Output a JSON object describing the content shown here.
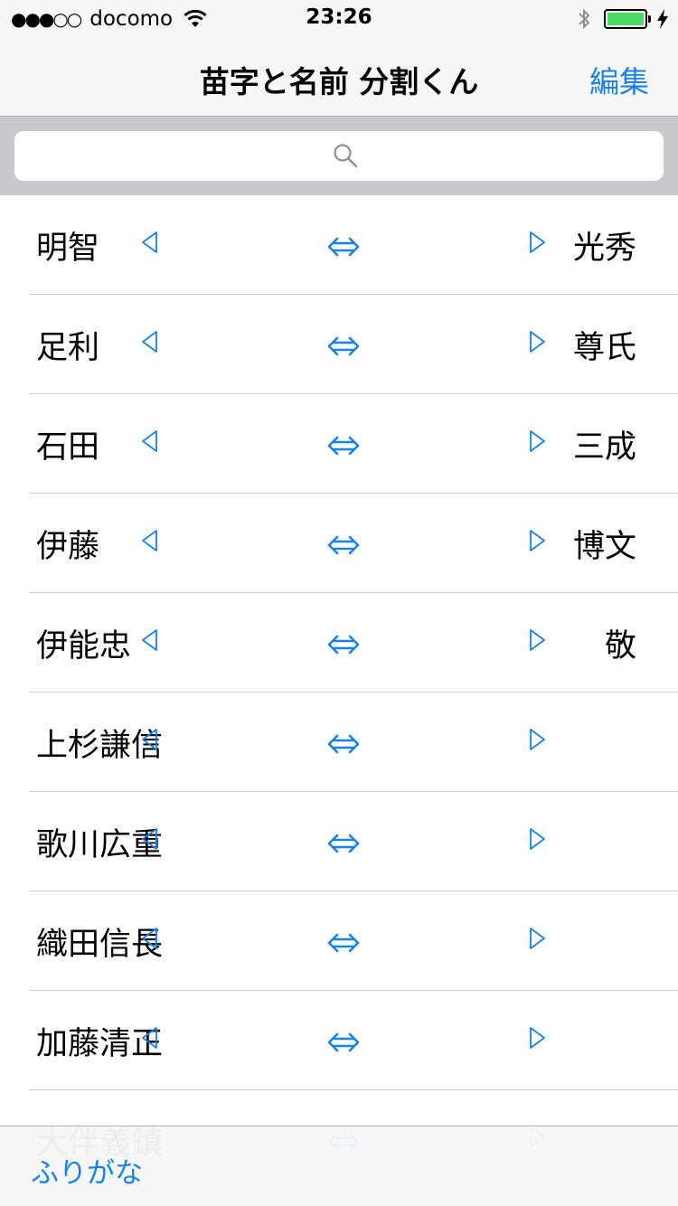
{
  "status_bar": {
    "signal": "●●●○○",
    "carrier": "docomo",
    "time": "23:26",
    "battery_color": "#4cd964"
  },
  "nav": {
    "title": "苗字と名前 分割くん",
    "edit_label": "編集"
  },
  "search": {
    "placeholder": "",
    "icon": "search-icon"
  },
  "accent_color": "#1a82e2",
  "rows": [
    {
      "first": "明智",
      "last": "光秀"
    },
    {
      "first": "足利",
      "last": "尊氏"
    },
    {
      "first": "石田",
      "last": "三成"
    },
    {
      "first": "伊藤",
      "last": "博文"
    },
    {
      "first": "伊能忠",
      "last": "敬"
    },
    {
      "first": "上杉謙信",
      "last": ""
    },
    {
      "first": "歌川広重",
      "last": ""
    },
    {
      "first": "織田信長",
      "last": ""
    },
    {
      "first": "加藤清正",
      "last": ""
    },
    {
      "first": "大伴義鎮",
      "last": ""
    }
  ],
  "toolbar": {
    "furigana_label": "ふりがな"
  }
}
